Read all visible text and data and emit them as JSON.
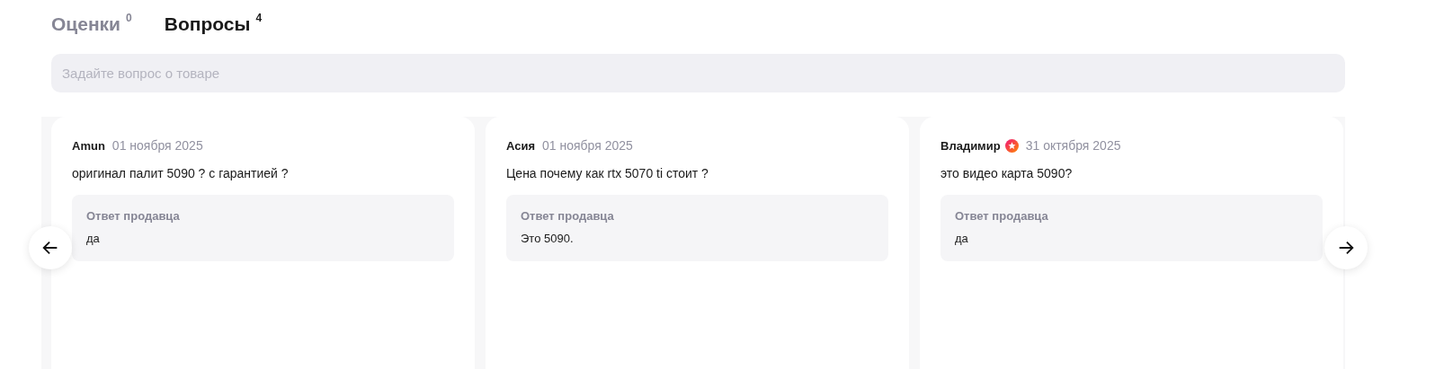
{
  "tabs": [
    {
      "label": "Оценки",
      "count": "0",
      "selected": false
    },
    {
      "label": "Вопросы",
      "count": "4",
      "selected": true
    }
  ],
  "search": {
    "placeholder": "Задайте вопрос о товаре"
  },
  "questions": [
    {
      "author": "Amun",
      "badge": false,
      "date": "01 ноября 2025",
      "text": "оригинал палит 5090 ? с гарантией ?",
      "answer_title": "Ответ продавца",
      "answer": "да"
    },
    {
      "author": "Асия",
      "badge": false,
      "date": "01 ноября 2025",
      "text": "Цена почему как rtx 5070 ti стоит ?",
      "answer_title": "Ответ продавца",
      "answer": "Это 5090."
    },
    {
      "author": "Владимир",
      "badge": true,
      "date": "31 октября 2025",
      "text": "это видео карта 5090?",
      "answer_title": "Ответ продавца",
      "answer": "да"
    }
  ]
}
